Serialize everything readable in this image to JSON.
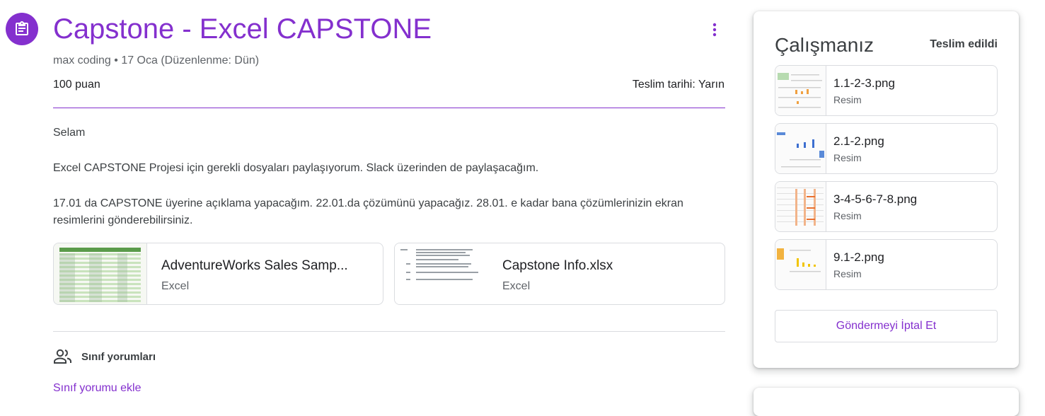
{
  "assignment": {
    "title": "Capstone - Excel CAPSTONE",
    "meta": "max coding • 17 Oca (Düzenlenme: Dün)",
    "points": "100 puan",
    "due": "Teslim tarihi: Yarın",
    "description": [
      "Selam",
      "Excel CAPSTONE Projesi için gerekli dosyaları paylaşıyorum. Slack üzerinden de paylaşacağım.",
      "17.01 da CAPSTONE üyerine açıklama yapacağım. 22.01.da çözümünü yapacağız. 28.01. e kadar bana çözümlerinizin ekran resimlerini gönderebilirsiniz."
    ],
    "attachments": [
      {
        "name": "AdventureWorks Sales Samp...",
        "type": "Excel"
      },
      {
        "name": "Capstone Info.xlsx",
        "type": "Excel"
      }
    ]
  },
  "comments": {
    "header": "Sınıf yorumları",
    "add_label": "Sınıf yorumu ekle"
  },
  "work_panel": {
    "title": "Çalışmanız",
    "status": "Teslim edildi",
    "files": [
      {
        "name": "1.1-2-3.png",
        "type": "Resim"
      },
      {
        "name": "2.1-2.png",
        "type": "Resim"
      },
      {
        "name": "3-4-5-6-7-8.png",
        "type": "Resim"
      },
      {
        "name": "9.1-2.png",
        "type": "Resim"
      }
    ],
    "unsubmit_label": "Göndermeyi İptal Et"
  },
  "colors": {
    "accent": "#8430ce",
    "border": "#dadce0",
    "muted": "#5f6368"
  },
  "icons": [
    "assignment-icon",
    "more-vert-icon",
    "people-icon"
  ]
}
